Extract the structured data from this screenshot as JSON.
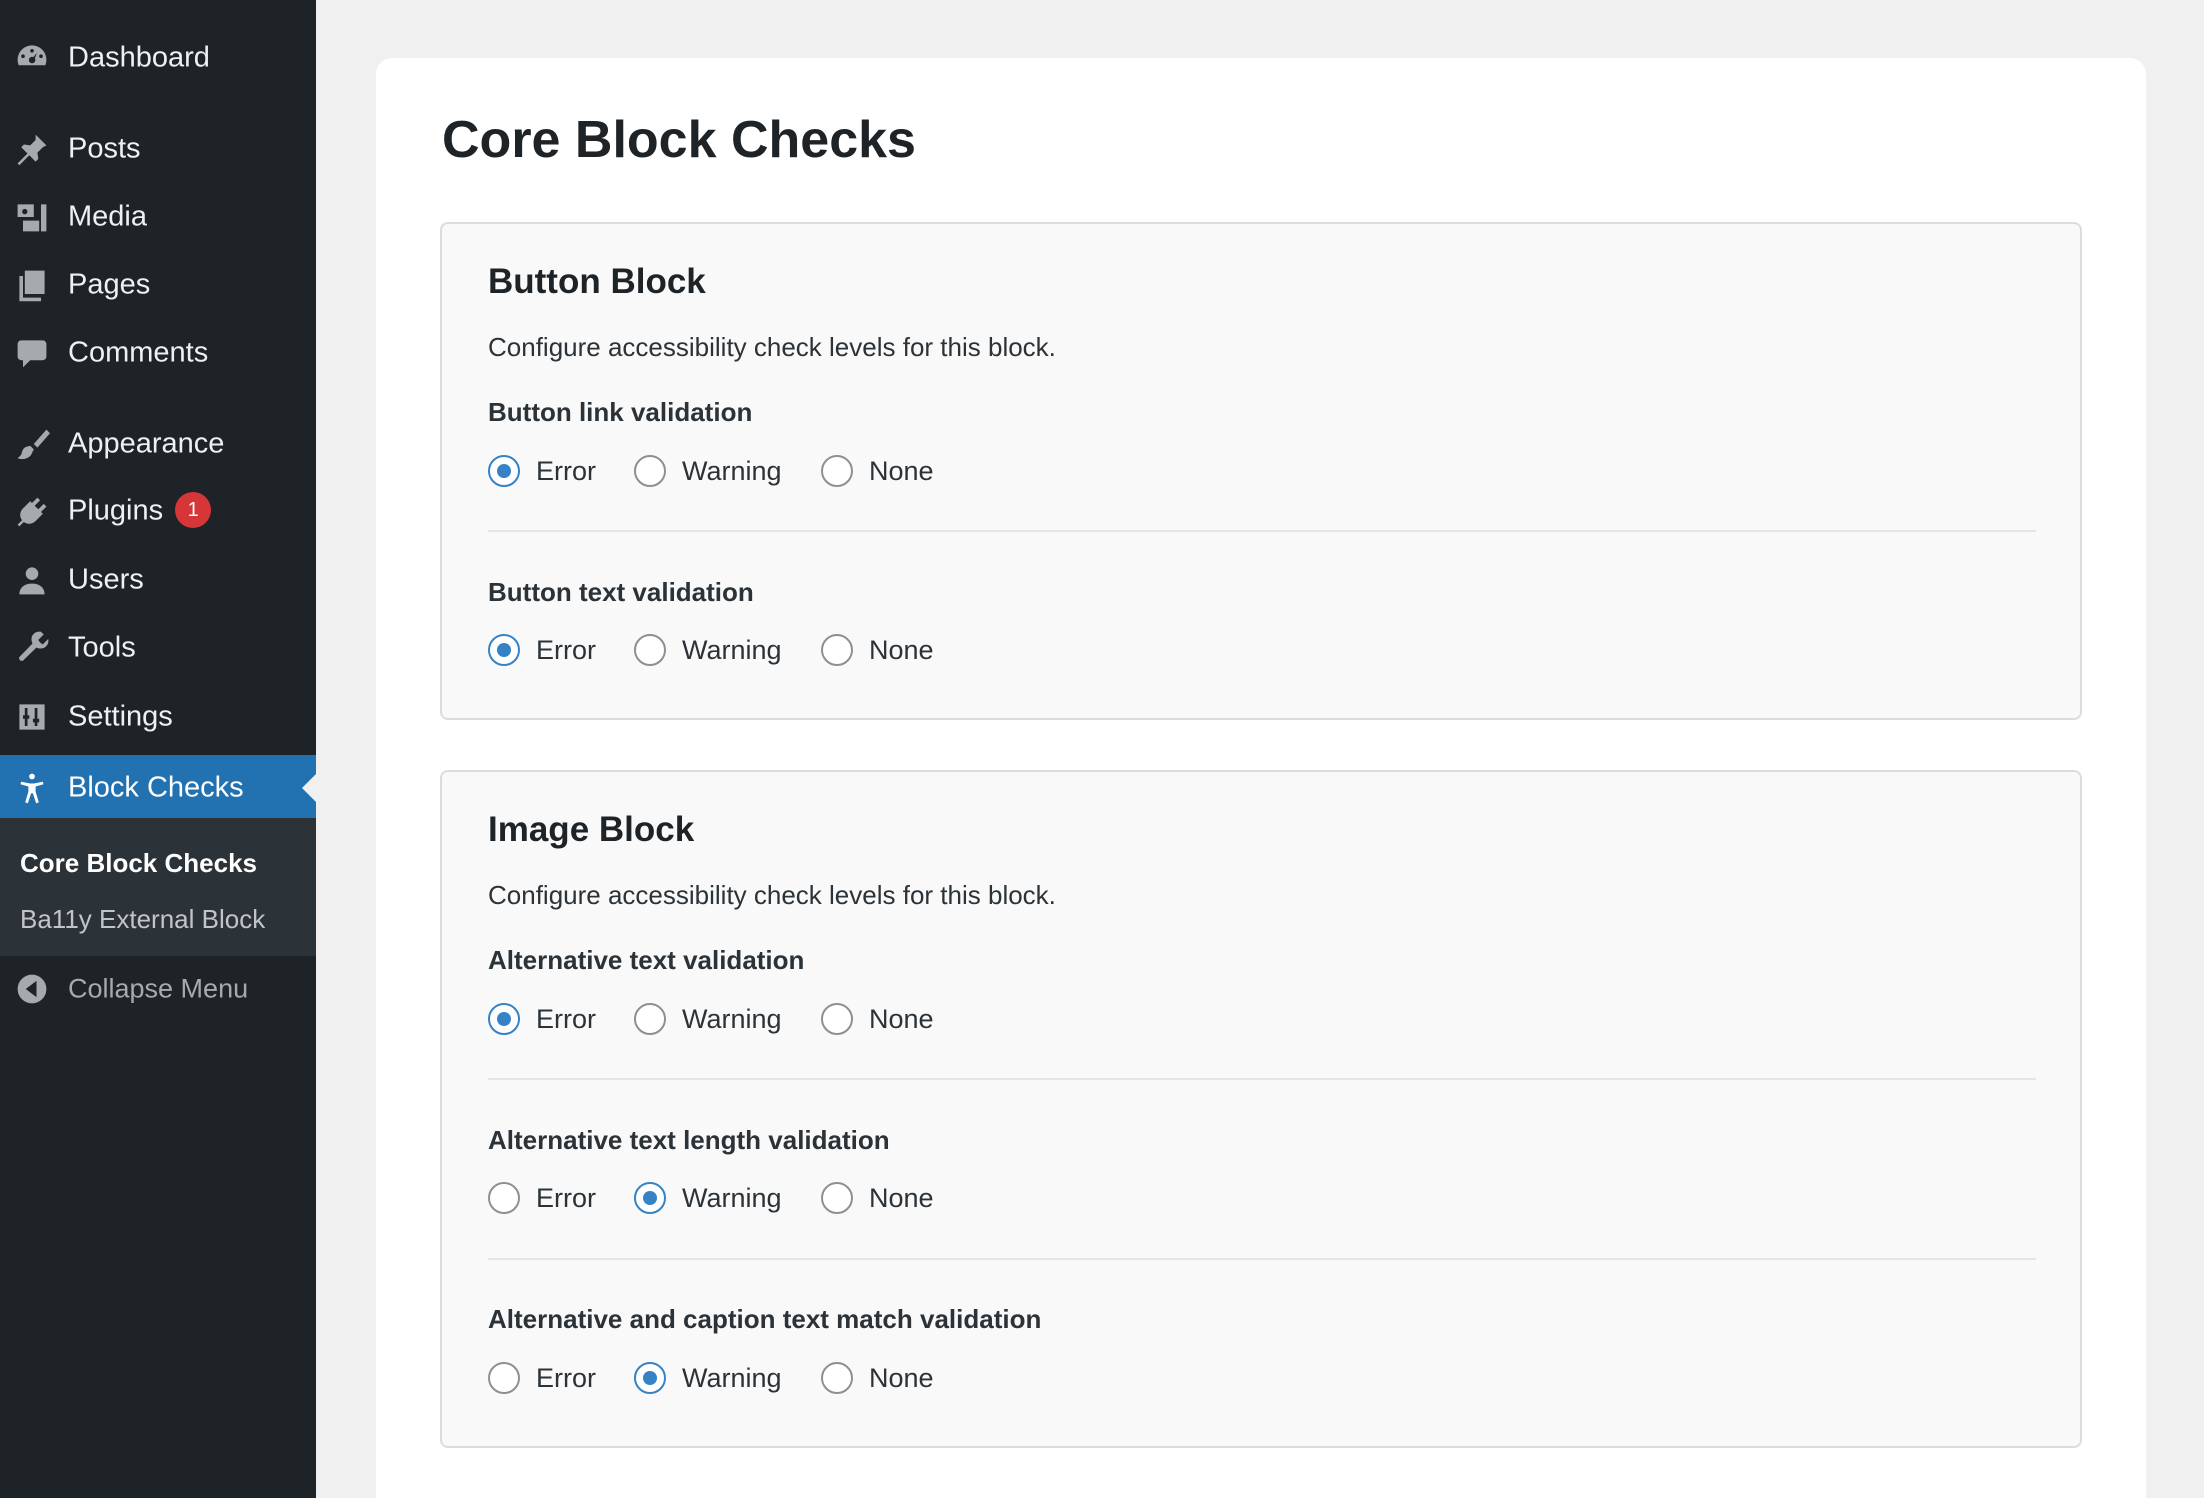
{
  "sidebar": {
    "items": [
      {
        "label": "Dashboard",
        "icon": "dashboard-icon"
      },
      {
        "label": "Posts",
        "icon": "pin-icon"
      },
      {
        "label": "Media",
        "icon": "media-icon"
      },
      {
        "label": "Pages",
        "icon": "pages-icon"
      },
      {
        "label": "Comments",
        "icon": "comment-icon"
      },
      {
        "label": "Appearance",
        "icon": "paintbrush-icon"
      },
      {
        "label": "Plugins",
        "icon": "plugin-icon",
        "badge": "1"
      },
      {
        "label": "Users",
        "icon": "user-icon"
      },
      {
        "label": "Tools",
        "icon": "wrench-icon"
      },
      {
        "label": "Settings",
        "icon": "settings-icon"
      },
      {
        "label": "Block Checks",
        "icon": "accessibility-icon",
        "current": true
      }
    ],
    "submenu": [
      {
        "label": "Core Block Checks",
        "current": true
      },
      {
        "label": "Ba11y External Block"
      }
    ],
    "collapse_label": "Collapse Menu"
  },
  "page": {
    "title": "Core Block Checks"
  },
  "options": {
    "error": "Error",
    "warning": "Warning",
    "none": "None"
  },
  "colors": {
    "sidebar_bg": "#1d2327",
    "accent": "#2271b1",
    "radio_checked": "#3582c4",
    "badge": "#d63638"
  },
  "cards": [
    {
      "title": "Button Block",
      "description": "Configure accessibility check levels for this block.",
      "fields": [
        {
          "label": "Button link validation",
          "selected": "Error"
        },
        {
          "label": "Button text validation",
          "selected": "Error"
        }
      ]
    },
    {
      "title": "Image Block",
      "description": "Configure accessibility check levels for this block.",
      "fields": [
        {
          "label": "Alternative text validation",
          "selected": "Error"
        },
        {
          "label": "Alternative text length validation",
          "selected": "Warning"
        },
        {
          "label": "Alternative and caption text match validation",
          "selected": "Warning"
        }
      ]
    }
  ]
}
